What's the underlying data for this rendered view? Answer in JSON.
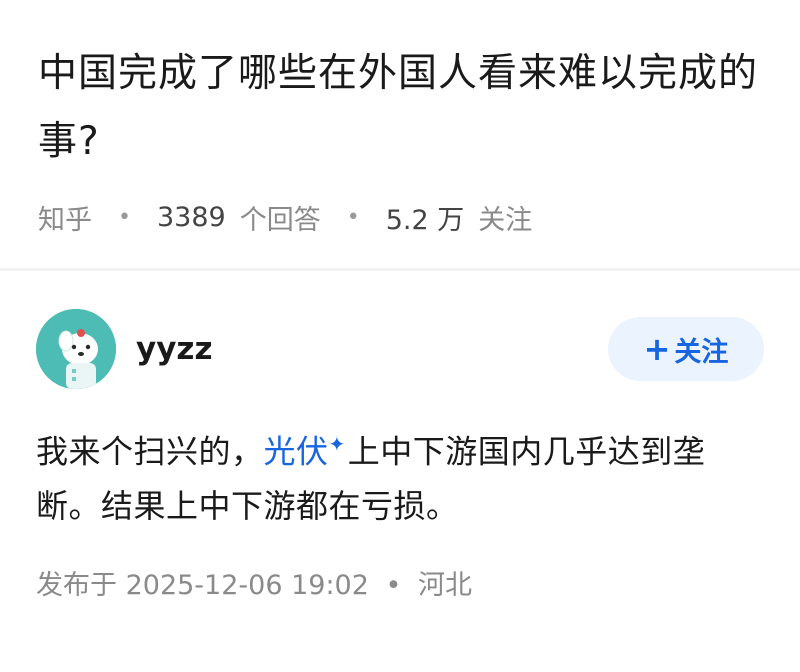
{
  "question": {
    "title": "中国完成了哪些在外国人看来难以完成的事?",
    "source": "知乎",
    "answer_count": "3389",
    "answer_word": "个回答",
    "follower_count": "5.2 万",
    "follower_word": "关注"
  },
  "answer": {
    "author_name": "yyzz",
    "avatar_icon": "cartoon-dog-avatar-icon",
    "follow_label": "关注",
    "body_prefix": "我来个扫兴的，",
    "keyword": "光伏",
    "body_suffix": "上中下游国内几乎达到垄断。结果上中下游都在亏损。",
    "published_label": "发布于",
    "published_time": "2025-12-06  19:02",
    "location": "河北"
  },
  "colors": {
    "accent": "#1766e0",
    "follow_bg": "#ebf3ff",
    "avatar_bg": "#4dbcb4",
    "muted_text": "#8a8a8a"
  }
}
